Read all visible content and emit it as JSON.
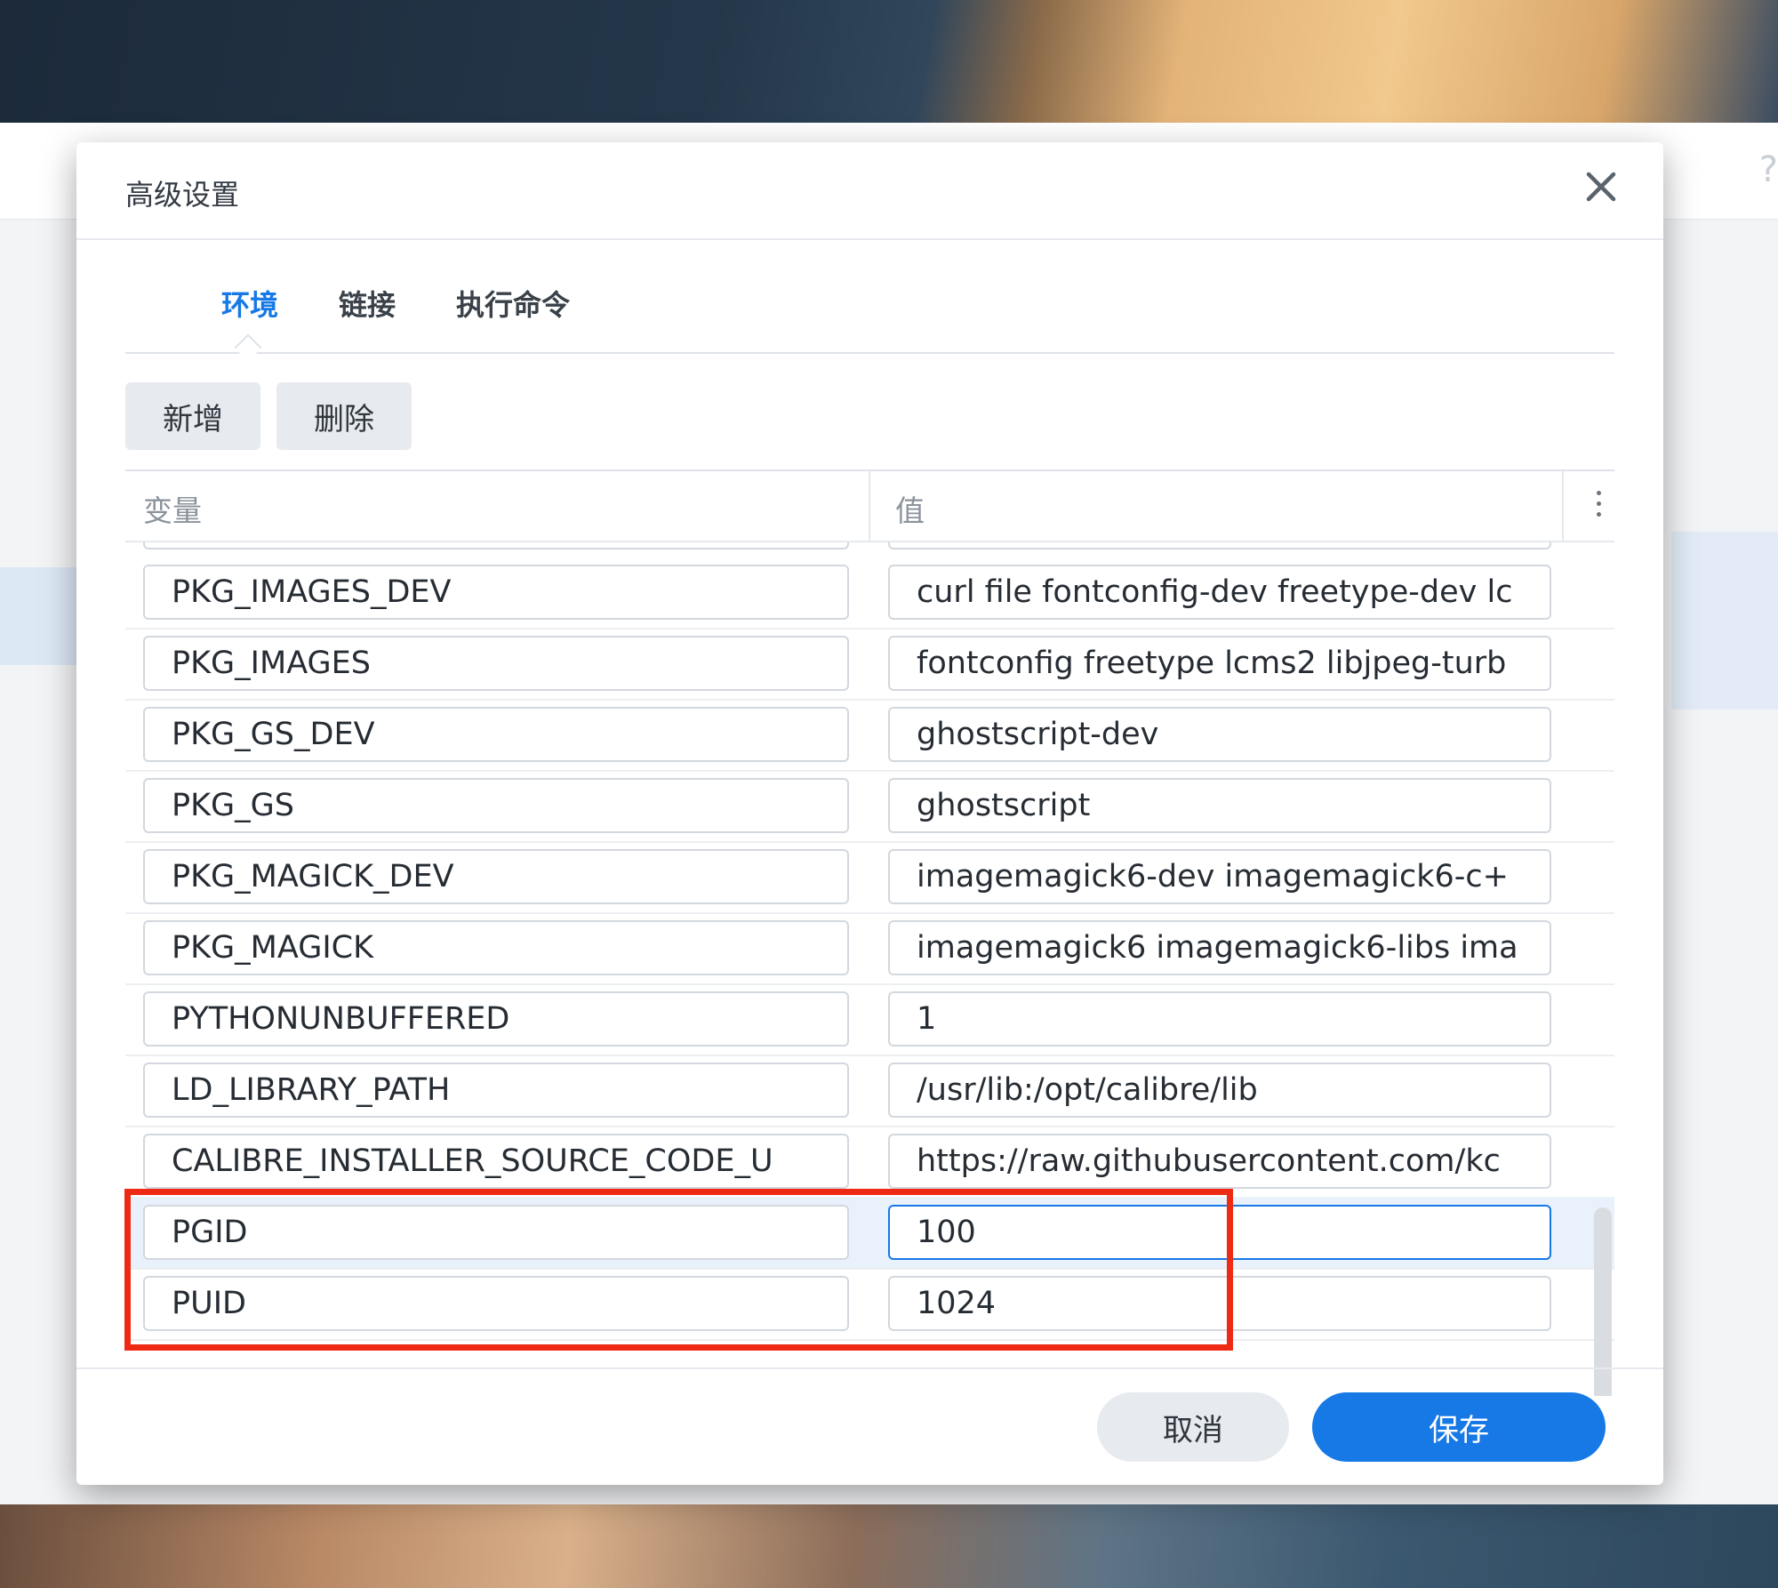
{
  "dialog": {
    "title": "高级设置"
  },
  "tabs": [
    {
      "label": "环境",
      "active": true
    },
    {
      "label": "链接",
      "active": false
    },
    {
      "label": "执行命令",
      "active": false
    }
  ],
  "toolbar": {
    "add_label": "新增",
    "delete_label": "删除"
  },
  "grid": {
    "col_variable": "变量",
    "col_value": "值",
    "rows": [
      {
        "variable": "PKG_IMAGES_DEV",
        "value": "curl file fontconfig-dev freetype-dev lc"
      },
      {
        "variable": "PKG_IMAGES",
        "value": "fontconfig freetype lcms2 libjpeg-turb"
      },
      {
        "variable": "PKG_GS_DEV",
        "value": "ghostscript-dev"
      },
      {
        "variable": "PKG_GS",
        "value": "ghostscript"
      },
      {
        "variable": "PKG_MAGICK_DEV",
        "value": "imagemagick6-dev imagemagick6-c+"
      },
      {
        "variable": "PKG_MAGICK",
        "value": "imagemagick6 imagemagick6-libs ima"
      },
      {
        "variable": "PYTHONUNBUFFERED",
        "value": "1"
      },
      {
        "variable": "LD_LIBRARY_PATH",
        "value": "/usr/lib:/opt/calibre/lib"
      },
      {
        "variable": "CALIBRE_INSTALLER_SOURCE_CODE_U",
        "value": "https://raw.githubusercontent.com/kc"
      },
      {
        "variable": "PGID",
        "value": "100"
      },
      {
        "variable": "PUID",
        "value": "1024"
      }
    ]
  },
  "footer": {
    "cancel_label": "取消",
    "save_label": "保存"
  },
  "colors": {
    "accent": "#1679e6",
    "highlight_border": "#ee2a14"
  }
}
